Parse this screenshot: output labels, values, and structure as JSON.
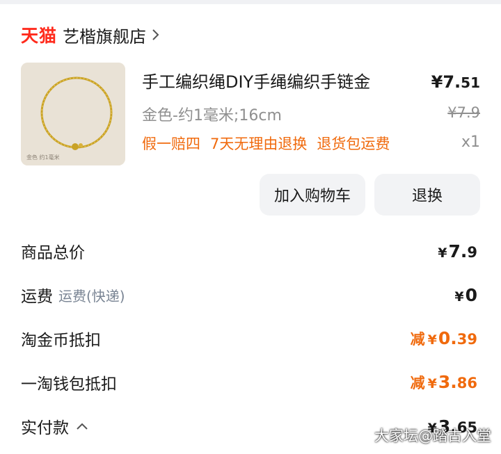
{
  "shop": {
    "brand": "天猫",
    "name": "艺楷旗舰店"
  },
  "product": {
    "title": "手工编织绳DIY手绳编织手链金",
    "price_main": "7.",
    "price_cents": "51",
    "variant": "金色-约1毫米;16cm",
    "original_price": "¥7.9",
    "quantity": "x1",
    "guarantees": [
      "假一赔四",
      "7天无理由退换",
      "退货包运费"
    ],
    "thumb_caption": "金色 约1毫米"
  },
  "actions": {
    "add_cart": "加入购物车",
    "return": "退换"
  },
  "summary": {
    "total_label": "商品总价",
    "total_value": "7.",
    "total_cents": "9",
    "shipping_label": "运费",
    "shipping_sub": "运费(快递)",
    "shipping_value": "0",
    "coin_label": "淘金币抵扣",
    "coin_prefix": "减",
    "coin_value": "0.",
    "coin_cents": "39",
    "wallet_label": "一淘钱包抵扣",
    "wallet_prefix": "减",
    "wallet_value": "3.",
    "wallet_cents": "86",
    "paid_label": "实付款",
    "paid_value": "3.",
    "paid_cents": "65"
  },
  "currency": "¥",
  "watermark": "大家坛@踏古入堂",
  "colors": {
    "brand_red": "#ff2a1c",
    "accent_orange": "#f06a0d",
    "muted": "#8f8f8f"
  },
  "icons": {
    "shop_arrow": "chevron-right-icon",
    "paid_toggle": "chevron-up-icon"
  }
}
